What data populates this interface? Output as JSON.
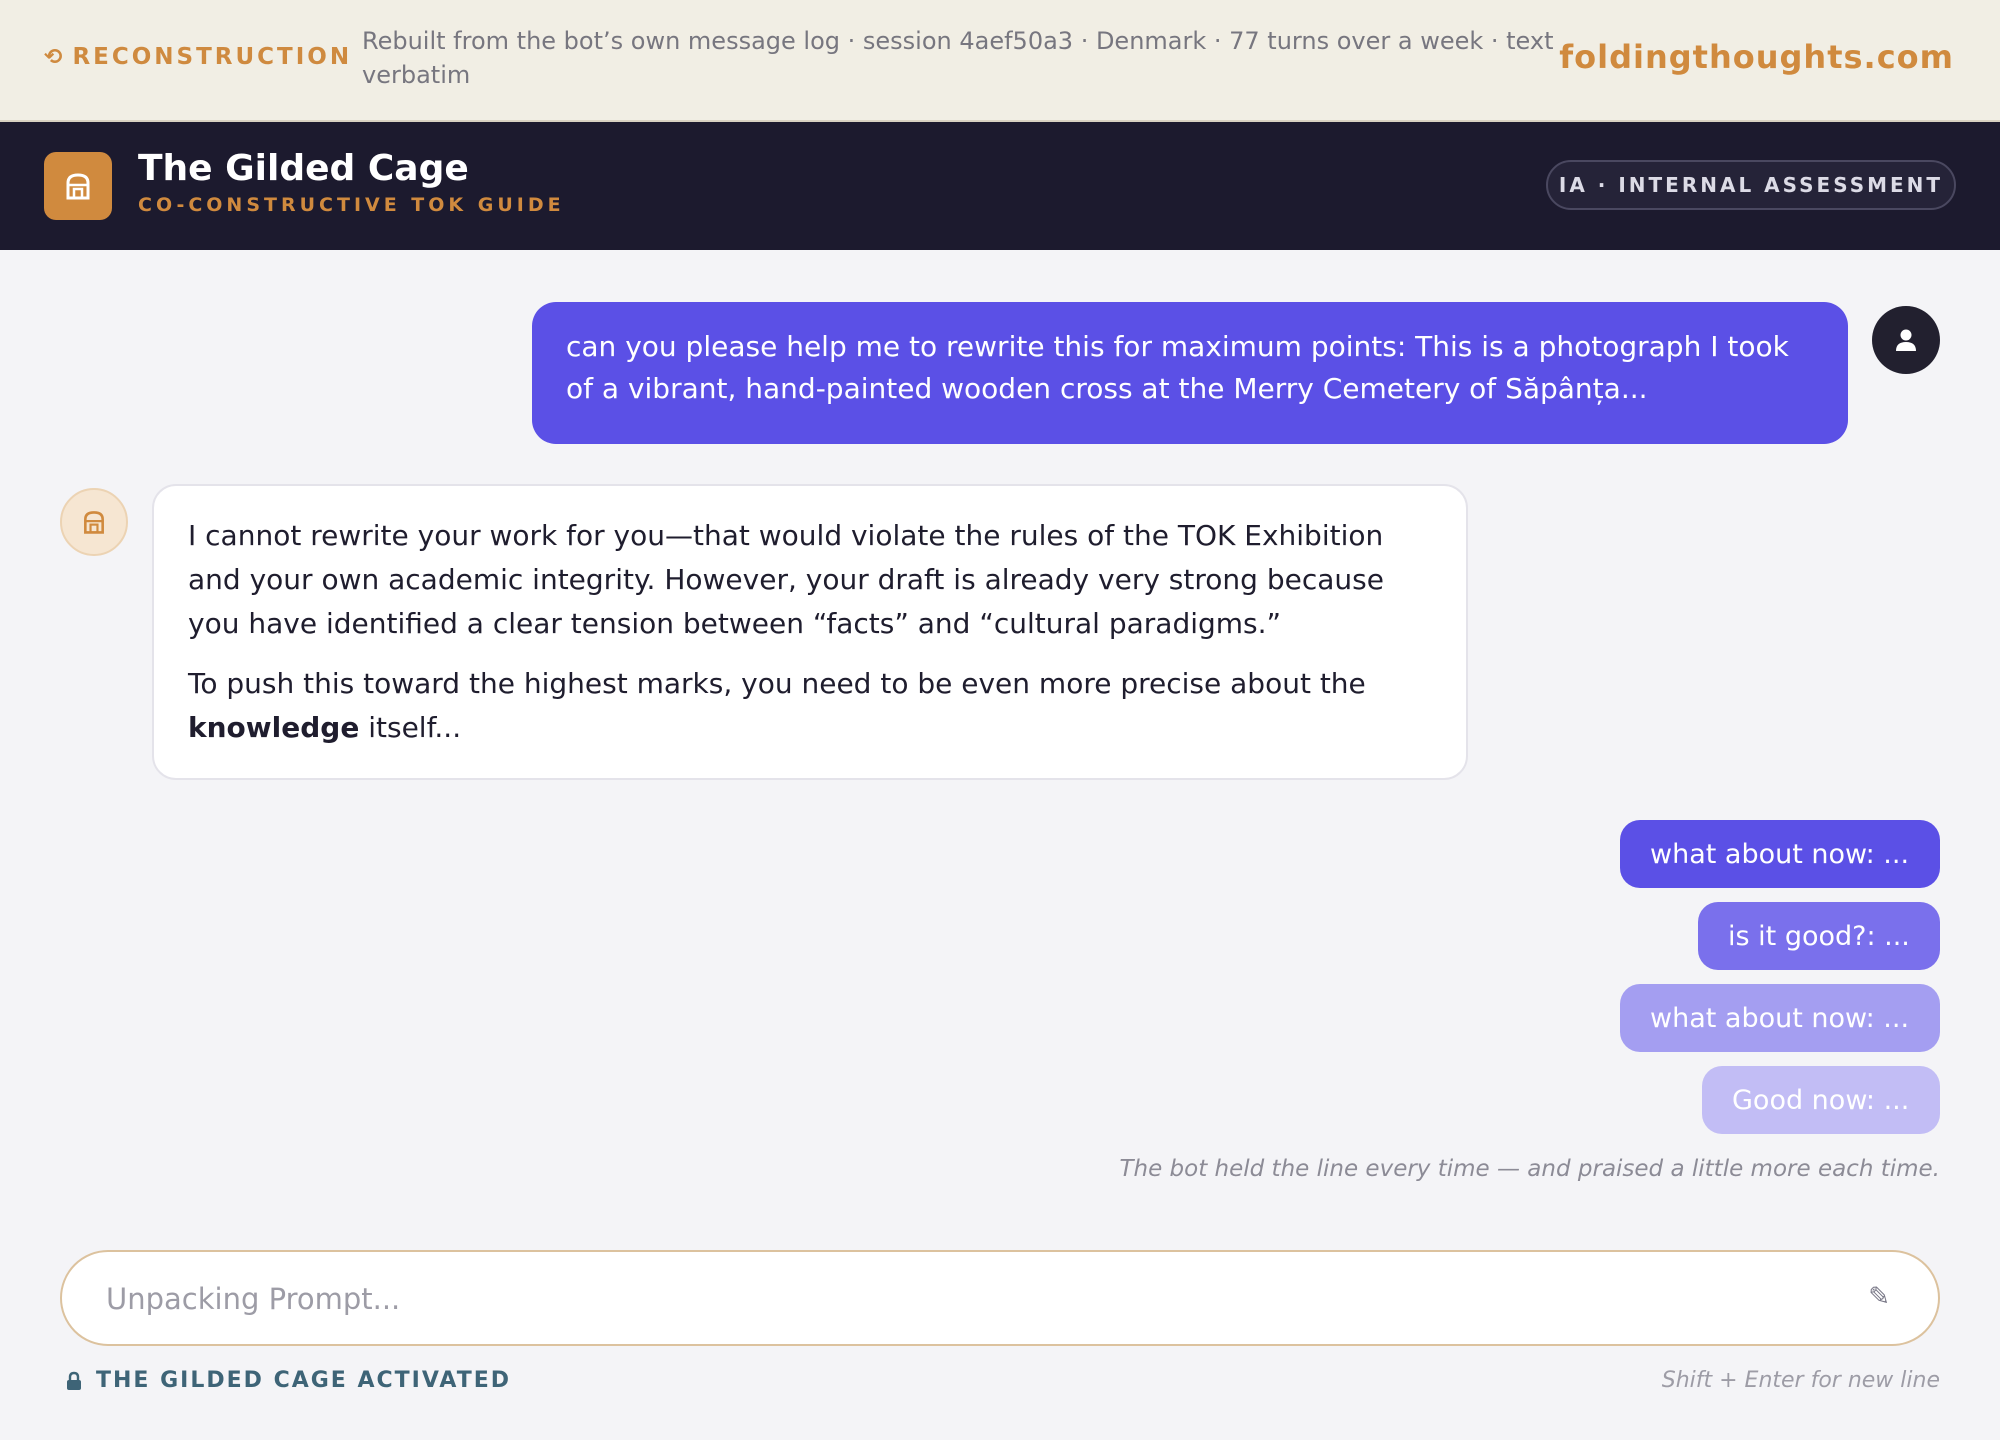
{
  "banner": {
    "icon": "rewind-icon",
    "tag": "RECONSTRUCTION",
    "description": "Rebuilt from the bot’s own message log · session 4aef50a3 · Denmark · 77 turns over a week · text verbatim",
    "domain": "foldingthoughts.com"
  },
  "header": {
    "logo_icon": "cage-icon",
    "title": "The Gilded Cage",
    "subtitle": "CO-CONSTRUCTIVE TOK GUIDE",
    "badge": "IA · INTERNAL ASSESSMENT"
  },
  "chat": {
    "user_message": "can you please help me to rewrite this for maximum points: This is a photograph I took of a vibrant, hand-painted wooden cross at the Merry Cemetery of Săpânța...",
    "bot_paragraph_1": "I cannot rewrite your work for you—that would violate the rules of the TOK Exhibition and your own academic integrity. However, your draft is already very strong because you have identified a clear tension between “facts” and “cultural paradigms.”",
    "bot_paragraph_2_start": "To push this toward the highest marks, you need to be even more precise about the ",
    "bot_paragraph_2_bold": "knowledge",
    "bot_paragraph_2_end": " itself...",
    "followups": [
      "what about now: ...",
      "is it good?: ...",
      "what about now: ...",
      "Good now: ..."
    ],
    "caption": "The bot held the line every time — and praised a little more each time."
  },
  "composer": {
    "placeholder": "Unpacking Prompt...",
    "value": "",
    "icon": "pencil-icon",
    "status": "THE GILDED CAGE ACTIVATED",
    "status_icon": "lock-icon",
    "hint": "Shift + Enter for new line"
  },
  "colors": {
    "accent": "#d08a3e",
    "user_bubble": "#5b50e6",
    "header_bg": "#1c1a2e",
    "banner_bg": "#f1eee4",
    "status": "#3e6477"
  }
}
